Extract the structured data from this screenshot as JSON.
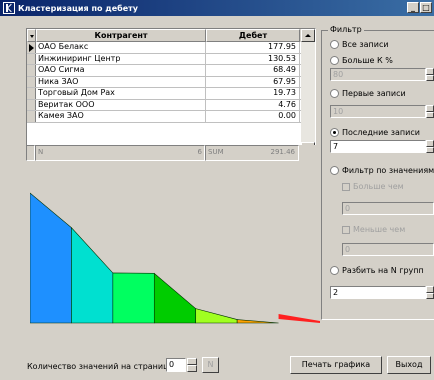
{
  "window": {
    "title": "Кластеризация по дебету",
    "min_label": "_",
    "max_label": "□"
  },
  "grid": {
    "columns": [
      "Контрагент",
      "Дебет"
    ],
    "rows": [
      {
        "name": "ОАО Белакс",
        "value": "177.95"
      },
      {
        "name": "Инжиниринг Центр",
        "value": "130.53"
      },
      {
        "name": "ОАО Сигма",
        "value": "68.49"
      },
      {
        "name": "Ника ЗАО",
        "value": "67.95"
      },
      {
        "name": "Торговый Дом Рах",
        "value": "19.73"
      },
      {
        "name": "Веритак ООО",
        "value": "4.76"
      },
      {
        "name": "Камея ЗАО",
        "value": "0.00"
      }
    ],
    "footer": {
      "n_label": "N",
      "n_value": "6",
      "sum_label": "SUM",
      "sum_value": "291.46"
    }
  },
  "filter": {
    "legend": "Фильтр",
    "all": "Все записи",
    "greater_k": "Больше К %",
    "greater_k_value": "80",
    "first": "Первые записи",
    "first_value": "10",
    "last": "Последние записи",
    "last_value": "7",
    "by_values": "Фильтр по значениям",
    "more_than": "Больше чем",
    "more_than_value": "0",
    "less_than": "Меньше чем",
    "less_than_value": "0",
    "split": "Разбить на N групп",
    "split_value": "2"
  },
  "bottom": {
    "per_page_label": "Количество значений на странице",
    "per_page_value": "0",
    "n_button": "N",
    "print_button": "Печать графика",
    "exit_button": "Выход"
  },
  "chart_data": {
    "type": "area",
    "x": [
      "ОАО Белакс",
      "Инжиниринг Центр",
      "ОАО Сигма",
      "Ника ЗАО",
      "Торговый Дом Рах",
      "Веритак ООО",
      "Камея ЗАО"
    ],
    "values": [
      177.95,
      130.53,
      68.49,
      67.95,
      19.73,
      4.76,
      0.0
    ],
    "colors": [
      "#1e90ff",
      "#00e0d0",
      "#00ff60",
      "#00cc00",
      "#a0ff20",
      "#ffa000",
      "#ff2020"
    ]
  }
}
